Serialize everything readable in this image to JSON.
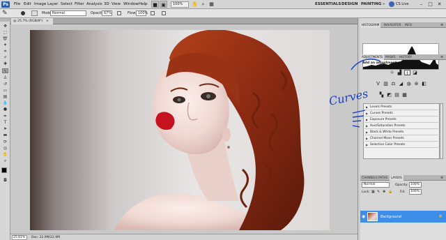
{
  "menubar": {
    "logo": "Ps",
    "items": [
      "File",
      "Edit",
      "Image",
      "Layer",
      "Select",
      "Filter",
      "Analysis",
      "3D",
      "View",
      "Window",
      "Help"
    ],
    "zoom": "100%",
    "workspaces": [
      "ESSENTIALS",
      "DESIGN",
      "PAINTING"
    ],
    "cs_live": "CS Live",
    "window_controls": [
      "–",
      "□",
      "✕"
    ]
  },
  "options": {
    "mode_label": "Mode:",
    "mode_value": "Normal",
    "opacity_label": "Opacity:",
    "opacity_value": "67%",
    "flow_label": "Flow:",
    "flow_value": "100%"
  },
  "document": {
    "tab_title": "@ 25.7% (RGB/8*)",
    "tab_close": "×"
  },
  "status": {
    "zoom": "25.61%",
    "doc_size": "Doc: 22.9M/22.9M"
  },
  "histogram_panel": {
    "tabs": [
      "HISTOGRAM",
      "NAVIGATOR",
      "INFO"
    ]
  },
  "adjustments_panel": {
    "tabs": [
      "ADJUSTMENTS",
      "MASKS",
      "HISTORY"
    ],
    "title": "Add an adjustment",
    "presets": [
      "Levels Presets",
      "Curves Presets",
      "Exposure Presets",
      "Hue/Saturation Presets",
      "Black & White Presets",
      "Channel Mixer Presets",
      "Selective Color Presets"
    ]
  },
  "layers_panel": {
    "tabs": [
      "CHANNELS",
      "PATHS",
      "LAYERS"
    ],
    "blend_mode": "Normal",
    "opacity_label": "Opacity:",
    "opacity_value": "100%",
    "lock_label": "Lock:",
    "fill_label": "Fill:",
    "fill_value": "100%",
    "layer_name": "Background"
  },
  "annotation": {
    "text": "Curves",
    "color": "#1a3fc9"
  },
  "colors": {
    "accent": "#3d8ee8",
    "hair": "#8a2a12",
    "lips": "#c4121e"
  }
}
